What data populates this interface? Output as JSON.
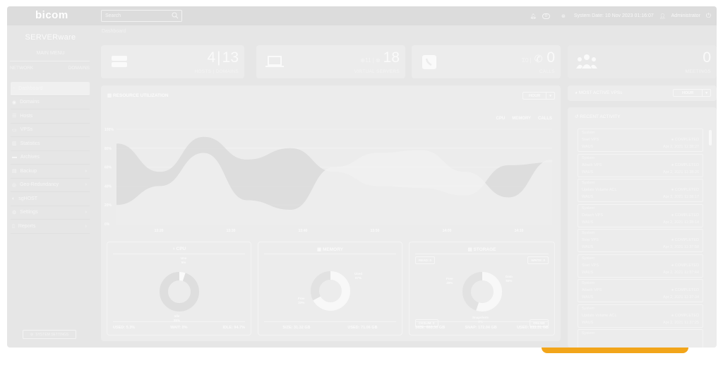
{
  "topbar": {
    "logo": "bicom",
    "search_placeholder": "Search",
    "bell_count": "0",
    "system_date": "System Date: 10 Nov 2023 01:16:07",
    "user": "Administrator"
  },
  "sidebar": {
    "brand": "SERVERware",
    "main_menu": "MAIN MENU",
    "tabs": [
      "NETWORK",
      "DOMAINS"
    ],
    "items": [
      {
        "label": "Dashboard",
        "icon": "dashboard-icon"
      },
      {
        "label": "Domains",
        "icon": "globe-icon"
      },
      {
        "label": "Hosts",
        "icon": "server-icon"
      },
      {
        "label": "VPSs",
        "icon": "monitor-icon"
      },
      {
        "label": "Statistics",
        "icon": "chart-icon"
      },
      {
        "label": "Archives",
        "icon": "archive-icon"
      },
      {
        "label": "Backup",
        "icon": "database-icon"
      },
      {
        "label": "Geo-Redundancy",
        "icon": "geo-icon"
      },
      {
        "label": "sgHOST",
        "icon": "shield-icon"
      },
      {
        "label": "Settings",
        "icon": "settings-icon"
      },
      {
        "label": "Reports",
        "icon": "document-icon"
      }
    ],
    "system_settings": "SYSTEM SETTINGS"
  },
  "breadcrumb": "Dashboard",
  "stats": {
    "hosts": "4",
    "domains": "13",
    "hosts_label": "HOSTS | DOMAINS",
    "vps_small": "⊕11 | ⊗",
    "vps": "18",
    "vps_label": "VIRTUAL SERVERS",
    "calls_small": "Σ0 |",
    "calls": "0",
    "calls_label": "CALLS",
    "meetings": "0",
    "meetings_label": "MEETINGS"
  },
  "resource": {
    "title": "RESOURCE UTILIZATION",
    "hour": "HOUR",
    "legend": [
      "CPU",
      "MEMORY",
      "CALLS"
    ],
    "yticks": [
      "100%",
      "80%",
      "60%",
      "40%",
      "20%",
      "0%"
    ],
    "xticks": [
      "13:20",
      "13:30",
      "13:40",
      "13:50",
      "14:00",
      "14:10"
    ]
  },
  "chart_data": {
    "type": "area",
    "categories": [
      "13:20",
      "13:30",
      "13:40",
      "13:50",
      "14:00",
      "14:10"
    ],
    "ylim": [
      0,
      100
    ],
    "series": [
      {
        "name": "CPU",
        "values": [
          85,
          55,
          92,
          68,
          80,
          55,
          40,
          38,
          30,
          62,
          65
        ]
      },
      {
        "name": "MEMORY",
        "values": [
          20,
          40,
          75,
          25,
          15,
          60,
          75,
          78,
          55,
          28,
          68
        ]
      }
    ]
  },
  "cpu": {
    "title": "CPU",
    "use_label": "Use",
    "use_value": "5%",
    "idle_label": "Idle",
    "idle_value": "95%",
    "used": "USED: 5.3%",
    "wait": "WAIT: 0%",
    "idle": "IDLE: 94.7%",
    "use_fraction": 0.05
  },
  "memory": {
    "title": "MEMORY",
    "used_label": "Used",
    "used_value": "67%",
    "free_label": "Free",
    "free_value": "33%",
    "size": "SIZE: 31.32 GB",
    "used": "USED: 71.06 GB",
    "used_fraction": 0.67
  },
  "storage": {
    "title": "STORAGE",
    "read": "READ: 0",
    "write": "WRITE: 0",
    "free_label": "Free",
    "free_value": "45%",
    "data_label": "Data",
    "data_value": "55%",
    "snap_label": "Snapshots",
    "snap_value": "0%",
    "ckslim": "CKSLIM: 0",
    "online": "ONLINE",
    "size": "SIZE: 660.30 GB",
    "snap": "SNAP: 172.04 GB",
    "used": "USED: 811.31 GB",
    "data_fraction": 0.55
  },
  "most_active": {
    "title": "MOST ACTIVE VPSs",
    "hour": "HOUR"
  },
  "recent": {
    "title": "RECENT ACTIVITY",
    "items": [
      {
        "source": "System",
        "action": "Start VPS",
        "target": "WAUS",
        "status": "COMPLETED",
        "time": "Apr 2, 2021 11:38:27"
      },
      {
        "source": "System",
        "action": "Attach VPS",
        "target": "WAUS",
        "status": "COMPLETED",
        "time": "Apr 2, 2021 11:38:26"
      },
      {
        "source": "System",
        "action": "Update Volume ACL",
        "target": "WAUS",
        "status": "COMPLETED",
        "time": "Apr 2, 2021 11:38:17"
      },
      {
        "source": "System",
        "action": "Detach VPS",
        "target": "WAUS",
        "status": "COMPLETED",
        "time": "Apr 2, 2021 11:38:14"
      },
      {
        "source": "System",
        "action": "Stop VPS",
        "target": "WAUS",
        "status": "COMPLETED",
        "time": "Apr 2, 2021 11:37:58"
      },
      {
        "source": "System",
        "action": "Start VPS",
        "target": "WAUS",
        "status": "COMPLETED",
        "time": "Apr 2, 2021 11:37:44"
      },
      {
        "source": "System",
        "action": "Attach VPS",
        "target": "WAUS",
        "status": "COMPLETED",
        "time": "Apr 2, 2021 11:37:34"
      },
      {
        "source": "System",
        "action": "Update Volume ACL",
        "target": "WAUS",
        "status": "COMPLETED",
        "time": "Apr 2, 2021 11:37:25"
      },
      {
        "source": "System",
        "action": "",
        "target": "",
        "status": "",
        "time": ""
      }
    ]
  }
}
